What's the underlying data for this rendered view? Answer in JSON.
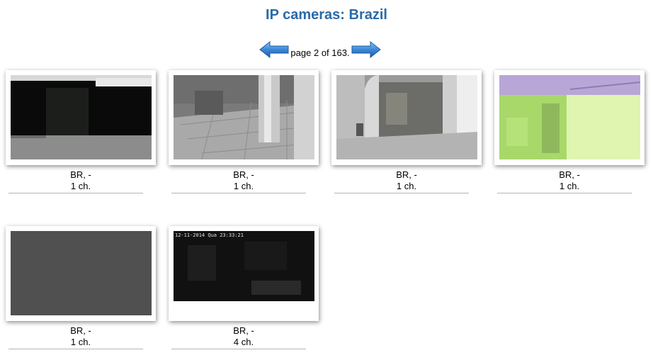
{
  "page": {
    "title": "IP cameras: Brazil"
  },
  "pager": {
    "prefix": "page",
    "current": "2",
    "of": "of",
    "total": "163."
  },
  "cameras": [
    {
      "location": "BR, -",
      "channels": "1 ch."
    },
    {
      "location": "BR, -",
      "channels": "1 ch."
    },
    {
      "location": "BR, -",
      "channels": "1 ch."
    },
    {
      "location": "BR, -",
      "channels": "1 ch."
    },
    {
      "location": "BR, -",
      "channels": "1 ch."
    },
    {
      "location": "BR, -",
      "channels": "4 ch.",
      "overlay": "12-11-2014 Qua 23:33:21"
    }
  ],
  "colors": {
    "title": "#2a6aa8",
    "arrow": "#3d87d9"
  }
}
